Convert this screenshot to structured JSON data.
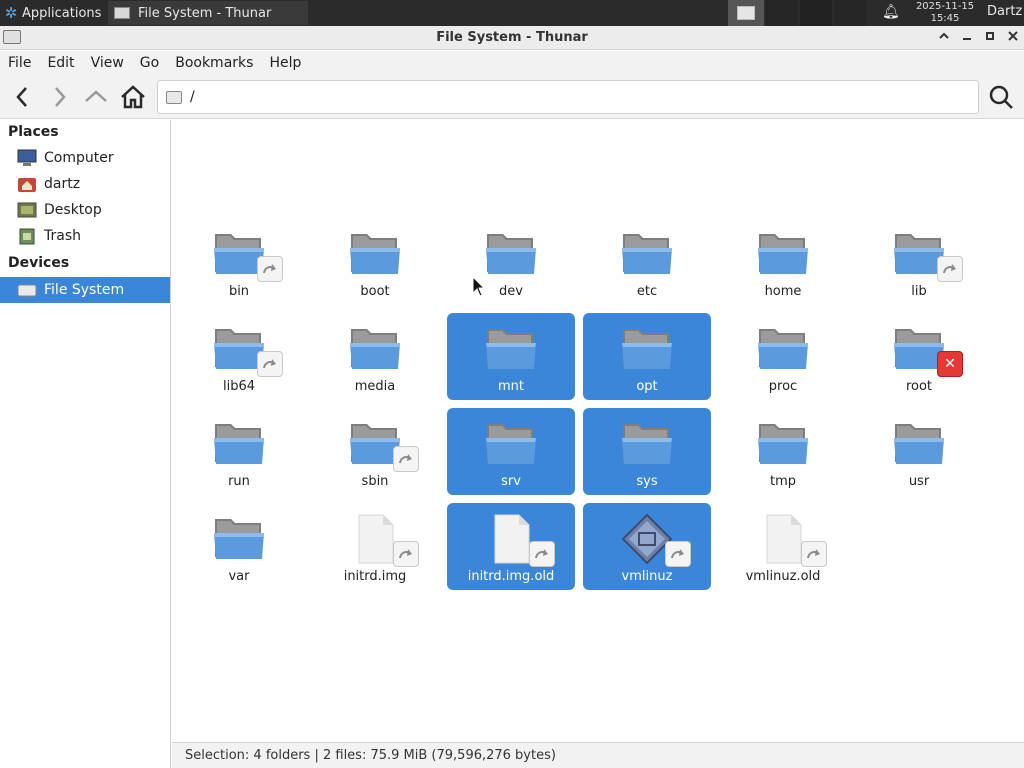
{
  "panel": {
    "applications_label": "Applications",
    "task_title": "File System - Thunar",
    "clock_date": "2025-11-15",
    "clock_time": "15:45",
    "user": "Dartz"
  },
  "window": {
    "title": "File System - Thunar"
  },
  "menu": [
    "File",
    "Edit",
    "View",
    "Go",
    "Bookmarks",
    "Help"
  ],
  "location": {
    "path": "/"
  },
  "sidebar": {
    "places_heading": "Places",
    "places": [
      {
        "label": "Computer",
        "icon": "computer-icon"
      },
      {
        "label": "dartz",
        "icon": "home-folder-icon"
      },
      {
        "label": "Desktop",
        "icon": "desktop-icon"
      },
      {
        "label": "Trash",
        "icon": "trash-icon"
      }
    ],
    "devices_heading": "Devices",
    "devices": [
      {
        "label": "File System",
        "icon": "drive-icon",
        "active": true
      }
    ]
  },
  "files": [
    {
      "name": "bin",
      "type": "folder",
      "overlay": "link",
      "selected": false
    },
    {
      "name": "boot",
      "type": "folder",
      "overlay": "",
      "selected": false
    },
    {
      "name": "dev",
      "type": "folder",
      "overlay": "",
      "selected": false
    },
    {
      "name": "etc",
      "type": "folder",
      "overlay": "",
      "selected": false
    },
    {
      "name": "home",
      "type": "folder",
      "overlay": "",
      "selected": false
    },
    {
      "name": "lib",
      "type": "folder",
      "overlay": "link",
      "selected": false
    },
    {
      "name": "lib64",
      "type": "folder",
      "overlay": "link",
      "selected": false
    },
    {
      "name": "media",
      "type": "folder",
      "overlay": "",
      "selected": false
    },
    {
      "name": "mnt",
      "type": "folder",
      "overlay": "",
      "selected": true
    },
    {
      "name": "opt",
      "type": "folder",
      "overlay": "",
      "selected": true
    },
    {
      "name": "proc",
      "type": "folder",
      "overlay": "",
      "selected": false
    },
    {
      "name": "root",
      "type": "folder",
      "overlay": "noaccess",
      "selected": false
    },
    {
      "name": "run",
      "type": "folder",
      "overlay": "",
      "selected": false
    },
    {
      "name": "sbin",
      "type": "folder",
      "overlay": "link",
      "selected": false
    },
    {
      "name": "srv",
      "type": "folder",
      "overlay": "",
      "selected": true
    },
    {
      "name": "sys",
      "type": "folder",
      "overlay": "",
      "selected": true
    },
    {
      "name": "tmp",
      "type": "folder",
      "overlay": "",
      "selected": false
    },
    {
      "name": "usr",
      "type": "folder",
      "overlay": "",
      "selected": false
    },
    {
      "name": "var",
      "type": "folder",
      "overlay": "",
      "selected": false
    },
    {
      "name": "initrd.img",
      "type": "file",
      "overlay": "link",
      "selected": false
    },
    {
      "name": "initrd.img.old",
      "type": "file",
      "overlay": "link",
      "selected": true
    },
    {
      "name": "vmlinuz",
      "type": "kernel",
      "overlay": "link",
      "selected": true
    },
    {
      "name": "vmlinuz.old",
      "type": "file",
      "overlay": "link",
      "selected": false
    }
  ],
  "status": {
    "text": "Selection: 4 folders  |  2 files: 75.9 MiB (79,596,276 bytes)"
  },
  "colors": {
    "selection": "#3b86d8",
    "panel": "#2b2b2b"
  }
}
